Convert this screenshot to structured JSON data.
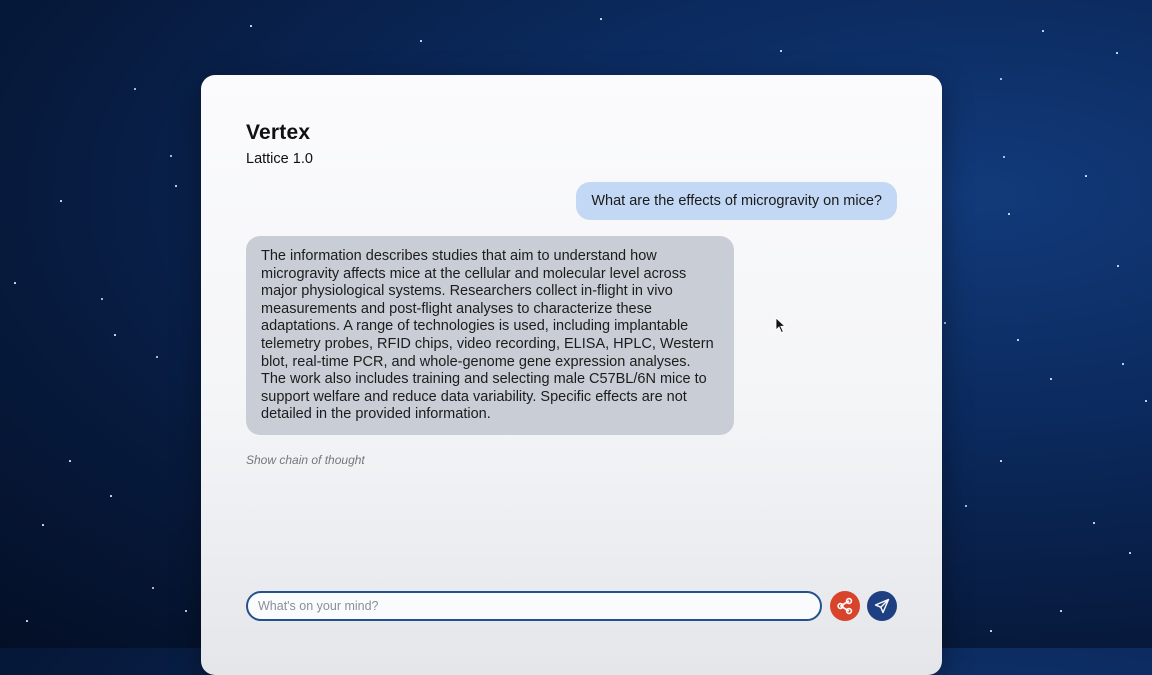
{
  "app": {
    "title": "Vertex",
    "subtitle": "Lattice 1.0"
  },
  "conversation": {
    "user_message": "What are the effects of microgravity on mice?",
    "assistant_message": "The information describes studies that aim to understand how microgravity affects mice at the cellular and molecular level across major physiological systems. Researchers collect in-flight in vivo measurements and post-flight analyses to characterize these adaptations. A range of technologies is used, including implantable telemetry probes, RFID chips, video recording, ELISA, HPLC, Western blot, real-time PCR, and whole-genome gene expression analyses. The work also includes training and selecting male C57BL/6N mice to support welfare and reduce data variability. Specific effects are not detailed in the provided information.",
    "chain_of_thought_link": "Show chain of thought"
  },
  "composer": {
    "placeholder": "What's on your mind?",
    "value": ""
  },
  "icons": {
    "share": "share-graph-icon",
    "send": "paper-plane-icon"
  },
  "colors": {
    "user_bubble": "#c3d8f4",
    "assistant_bubble": "#c9ced6",
    "share_button": "#d8432c",
    "send_button": "#1e3f82",
    "input_border": "#24508f"
  }
}
